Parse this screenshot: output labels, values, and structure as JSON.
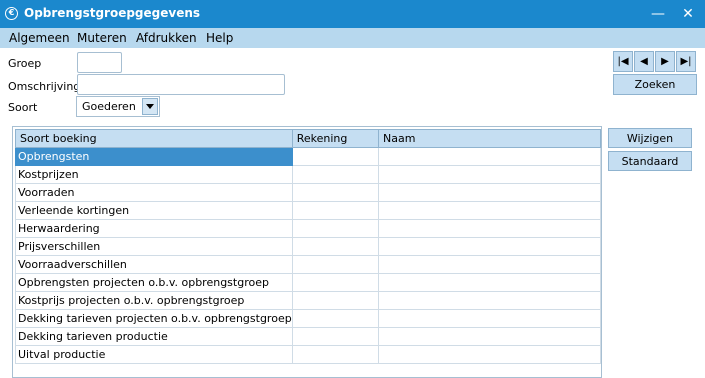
{
  "window": {
    "title": "Opbrengstgroepgegevens"
  },
  "menu": {
    "items": [
      "Algemeen",
      "Muteren",
      "Afdrukken",
      "Help"
    ]
  },
  "form": {
    "groep_label": "Groep",
    "groep_value": "",
    "omschrijving_label": "Omschrijving",
    "omschrijving_value": "",
    "soort_label": "Soort",
    "soort_value": "Goederen"
  },
  "buttons": {
    "zoeken": "Zoeken",
    "wijzigen": "Wijzigen",
    "standaard": "Standaard"
  },
  "grid": {
    "columns": [
      "Soort boeking",
      "Rekening",
      "Naam"
    ],
    "selected_row": 0,
    "rows": [
      [
        "Opbrengsten",
        "",
        ""
      ],
      [
        "Kostprijzen",
        "",
        ""
      ],
      [
        "Voorraden",
        "",
        ""
      ],
      [
        "Verleende kortingen",
        "",
        ""
      ],
      [
        "Herwaardering",
        "",
        ""
      ],
      [
        "Prijsverschillen",
        "",
        ""
      ],
      [
        "Voorraadverschillen",
        "",
        ""
      ],
      [
        "Opbrengsten projecten o.b.v. opbrengstgroep",
        "",
        ""
      ],
      [
        "Kostprijs projecten o.b.v. opbrengstgroep",
        "",
        ""
      ],
      [
        "Dekking tarieven projecten o.b.v. opbrengstgroep",
        "",
        ""
      ],
      [
        "Dekking tarieven productie",
        "",
        ""
      ],
      [
        "Uitval productie",
        "",
        ""
      ]
    ]
  }
}
